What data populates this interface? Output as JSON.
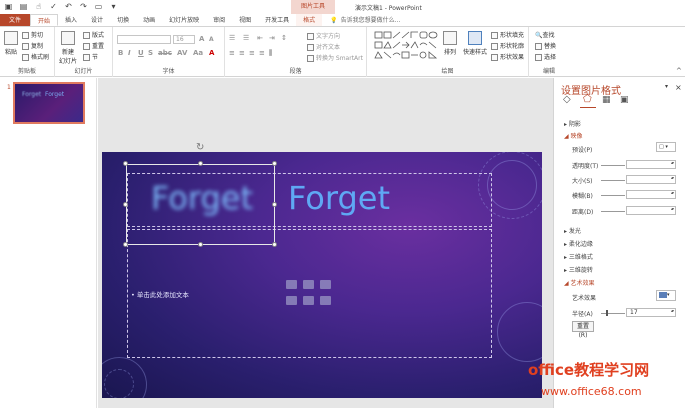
{
  "titlebar": {
    "doc_title": "演示文稿1 - PowerPoint",
    "context_tab": "图片工具"
  },
  "tabs": [
    "文件",
    "开始",
    "插入",
    "设计",
    "切换",
    "动画",
    "幻灯片放映",
    "审阅",
    "视图",
    "开发工具",
    "格式"
  ],
  "tellme": "告诉我您想要做什么...",
  "ribbon": {
    "clipboard": {
      "paste": "粘贴",
      "cut": "剪切",
      "copy": "复制",
      "painter": "格式刷",
      "label": "剪贴板"
    },
    "slides": {
      "new": "新建",
      "new2": "幻灯片",
      "layout": "版式",
      "reset": "重置",
      "section": "节",
      "label": "幻灯片"
    },
    "font": {
      "label": "字体",
      "size": "16"
    },
    "paragraph": {
      "textdir": "文字方向",
      "align": "对齐文本",
      "smartart": "转换为 SmartArt",
      "label": "段落"
    },
    "drawing": {
      "arrange": "排列",
      "quickstyle": "快速样式",
      "fill": "形状填充",
      "outline": "形状轮廓",
      "effects": "形状效果",
      "label": "绘图"
    },
    "editing": {
      "find": "查找",
      "replace": "替换",
      "select": "选择",
      "label": "编辑"
    }
  },
  "thumbnail": {
    "number": "1",
    "text1": "Forget",
    "text2": "Forget"
  },
  "slide": {
    "title_blur": "Forget",
    "title_sharp": "Forget",
    "body_placeholder": "单击此处添加文本"
  },
  "panel": {
    "title": "设置图片格式",
    "shadow": "阴影",
    "reflection": "映像",
    "preset": "预设(P)",
    "transparency": "透明度(T)",
    "size": "大小(S)",
    "blur": "模糊(B)",
    "distance": "距离(D)",
    "glow": "发光",
    "soft_edges": "柔化边缘",
    "format3d": "三维格式",
    "rotation3d": "三维旋转",
    "artistic": "艺术效果",
    "artistic_label": "艺术效果",
    "radius": "半径(A)",
    "radius_value": "17",
    "reset": "重置(R)"
  },
  "watermark": {
    "line1": "office教程学习网",
    "line2": "www.office68.com"
  },
  "colors": {
    "accent": "#b7472a"
  }
}
